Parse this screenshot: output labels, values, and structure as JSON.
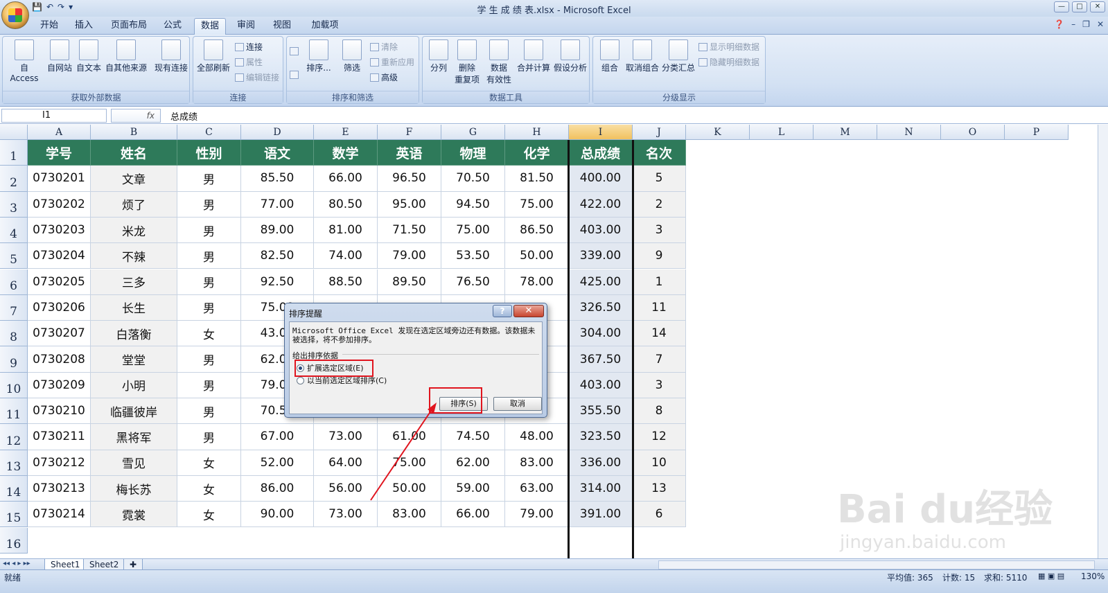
{
  "window": {
    "title": "学 生 成 绩 表.xlsx - Microsoft Excel",
    "controls": [
      "—",
      "□",
      "✕"
    ]
  },
  "quick_access": {
    "save": "💾",
    "undo": "↶",
    "redo": "↷",
    "customize": "▾"
  },
  "tabs": [
    "开始",
    "插入",
    "页面布局",
    "公式",
    "数据",
    "审阅",
    "视图",
    "加载项"
  ],
  "active_tab": "数据",
  "ribbon": {
    "groups": {
      "external": {
        "label": "获取外部数据",
        "buttons": [
          "自 Access",
          "自网站",
          "自文本",
          "自其他来源",
          "现有连接"
        ]
      },
      "connections": {
        "label": "连接",
        "refresh": "全部刷新",
        "small": [
          "连接",
          "属性",
          "编辑链接"
        ]
      },
      "sort_filter": {
        "label": "排序和筛选",
        "sort": "排序...",
        "filter": "筛选",
        "small": [
          "清除",
          "重新应用",
          "高级"
        ]
      },
      "data_tools": {
        "label": "数据工具",
        "buttons": [
          "分列",
          "删除\n重复项",
          "数据\n有效性",
          "合并计算",
          "假设分析"
        ]
      },
      "outline": {
        "label": "分级显示",
        "buttons": [
          "组合",
          "取消组合",
          "分类汇总"
        ],
        "small": [
          "显示明细数据",
          "隐藏明细数据"
        ]
      }
    }
  },
  "formula_bar": {
    "name_box": "I1",
    "fx": "fx",
    "content": "总成绩"
  },
  "columns": [
    "A",
    "B",
    "C",
    "D",
    "E",
    "F",
    "G",
    "H",
    "I",
    "J",
    "K",
    "L",
    "M",
    "N",
    "O",
    "P"
  ],
  "rows": [
    "1",
    "2",
    "3",
    "4",
    "5",
    "6",
    "7",
    "8",
    "9",
    "10",
    "11",
    "12",
    "13",
    "14",
    "15",
    "16"
  ],
  "table": {
    "headers": [
      "学号",
      "姓名",
      "性别",
      "语文",
      "数学",
      "英语",
      "物理",
      "化学",
      "总成绩",
      "名次"
    ],
    "rows": [
      [
        "0730201",
        "文章",
        "男",
        "85.50",
        "66.00",
        "96.50",
        "70.50",
        "81.50",
        "400.00",
        "5"
      ],
      [
        "0730202",
        "烦了",
        "男",
        "77.00",
        "80.50",
        "95.00",
        "94.50",
        "75.00",
        "422.00",
        "2"
      ],
      [
        "0730203",
        "米龙",
        "男",
        "89.00",
        "81.00",
        "71.50",
        "75.00",
        "86.50",
        "403.00",
        "3"
      ],
      [
        "0730204",
        "不辣",
        "男",
        "82.50",
        "74.00",
        "79.00",
        "53.50",
        "50.00",
        "339.00",
        "9"
      ],
      [
        "0730205",
        "三多",
        "男",
        "92.50",
        "88.50",
        "89.50",
        "76.50",
        "78.00",
        "425.00",
        "1"
      ],
      [
        "0730206",
        "长生",
        "男",
        "75.00",
        "",
        "",
        "",
        "",
        "326.50",
        "11"
      ],
      [
        "0730207",
        "白落衡",
        "女",
        "43.00",
        "",
        "",
        "",
        "",
        "304.00",
        "14"
      ],
      [
        "0730208",
        "堂堂",
        "男",
        "62.00",
        "",
        "",
        "",
        "",
        "367.50",
        "7"
      ],
      [
        "0730209",
        "小明",
        "男",
        "79.00",
        "",
        "",
        "",
        "",
        "403.00",
        "3"
      ],
      [
        "0730210",
        "临疆彼岸",
        "男",
        "70.50",
        "",
        "",
        "",
        "",
        "355.50",
        "8"
      ],
      [
        "0730211",
        "黑将军",
        "男",
        "67.00",
        "73.00",
        "61.00",
        "74.50",
        "48.00",
        "323.50",
        "12"
      ],
      [
        "0730212",
        "雪见",
        "女",
        "52.00",
        "64.00",
        "75.00",
        "62.00",
        "83.00",
        "336.00",
        "10"
      ],
      [
        "0730213",
        "梅长苏",
        "女",
        "86.00",
        "56.00",
        "50.00",
        "59.00",
        "63.00",
        "314.00",
        "13"
      ],
      [
        "0730214",
        "霓裳",
        "女",
        "90.00",
        "73.00",
        "83.00",
        "66.00",
        "79.00",
        "391.00",
        "6"
      ]
    ]
  },
  "sheet_tabs": [
    "Sheet1",
    "Sheet2"
  ],
  "status": {
    "ready": "就绪",
    "average": "平均值: 365",
    "count": "计数: 15",
    "sum": "求和: 5110",
    "zoom": "130%"
  },
  "dialog": {
    "title": "排序提醒",
    "help": "?",
    "close": "✕",
    "message": "Microsoft Office Excel 发现在选定区域旁边还有数据。该数据未被选择，将不参加排序。",
    "group_label": "给出排序依据",
    "option1": "扩展选定区域(E)",
    "option2": "以当前选定区域排序(C)",
    "sort_button": "排序(S)",
    "cancel_button": "取消"
  },
  "watermark": {
    "text1": "Bai du经验",
    "text2": "jingyan.baidu.com"
  },
  "colors": {
    "header_green": "#2e7a5a",
    "annotation_red": "#e0141e"
  }
}
